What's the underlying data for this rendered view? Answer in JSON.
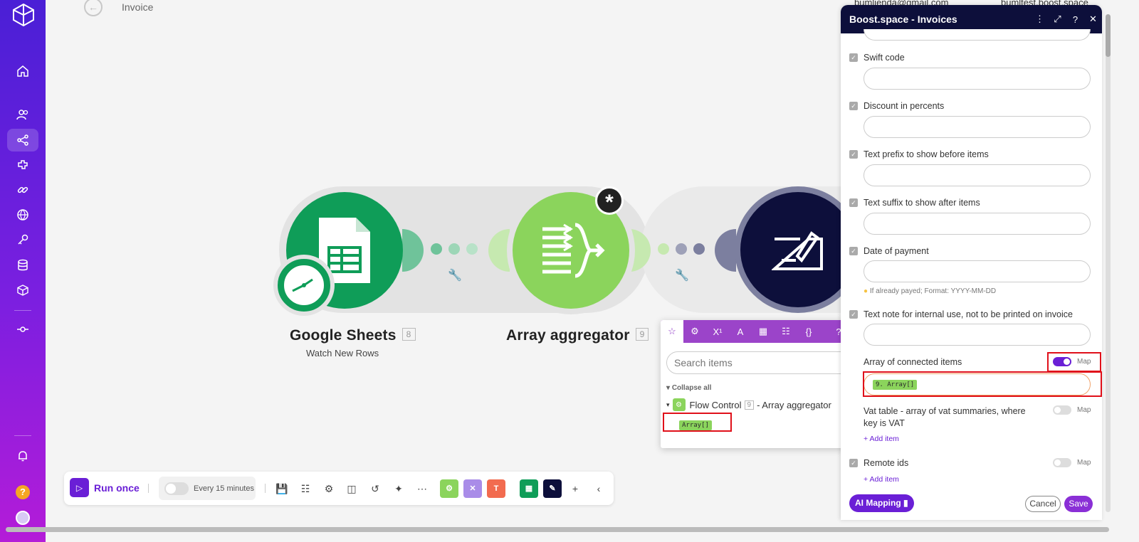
{
  "header": {
    "title": "Invoice",
    "user_email": "bumlienda@gmail.com",
    "org": "bumltest.boost.space"
  },
  "sidebar": {
    "items": [
      "home-icon",
      "users-icon",
      "scenarios-icon",
      "apps-icon",
      "connections-icon",
      "webhooks-icon",
      "keys-icon",
      "datastores-icon",
      "devices-icon",
      "flow-icon"
    ],
    "help_label": "?"
  },
  "canvas": {
    "nodes": [
      {
        "name": "Google Sheets",
        "num": "8",
        "sub": "Watch New Rows",
        "color": "#0f9d58"
      },
      {
        "name": "Array aggregator",
        "num": "9",
        "color": "#8bd45c"
      }
    ],
    "badge": "*"
  },
  "toolbar": {
    "run_label": "Run once",
    "schedule_label": "Every 15 minutes"
  },
  "popup": {
    "search_placeholder": "Search items",
    "collapse_label": "Collapse all",
    "module_name": "Flow Control",
    "module_num": "9",
    "module_suffix": "- Array aggregator",
    "item_label": "Array[]"
  },
  "panel": {
    "title": "Boost.space - Invoices",
    "fields": [
      {
        "label": "Swift code"
      },
      {
        "label": "Discount in percents"
      },
      {
        "label": "Text prefix to show before items"
      },
      {
        "label": "Text suffix to show after items"
      },
      {
        "label": "Date of payment",
        "hint": "If already payed; Format: YYYY-MM-DD"
      },
      {
        "label": "Text note for internal use, not to be printed on invoice"
      }
    ],
    "array_label": "Array of connected items",
    "array_value": "9. Array[]",
    "map_label": "Map",
    "vat_label": "Vat table - array of vat summaries, where key is VAT",
    "remote_label": "Remote ids",
    "add_item_label": "Add item",
    "ai_label": "AI Mapping",
    "cancel_label": "Cancel",
    "save_label": "Save"
  }
}
